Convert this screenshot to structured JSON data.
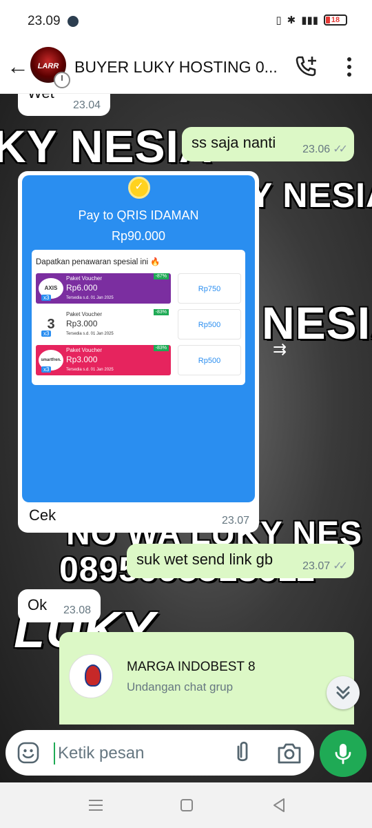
{
  "status_bar": {
    "time": "23.09",
    "battery": "18"
  },
  "header": {
    "title": "BUYER LUKY HOSTING 0...",
    "avatar_label": "LARR"
  },
  "watermark": {
    "line1": "KY NESIA",
    "line2": "Y NESIA",
    "line3": "NESIA",
    "line4": "NO WA LUKY NES",
    "line5": "0895095518611",
    "line6": "LUKY"
  },
  "messages": [
    {
      "dir": "in",
      "text": "Wet",
      "time": "23.04"
    },
    {
      "dir": "out",
      "text": "ss saja nanti",
      "time": "23.06"
    },
    {
      "dir": "in",
      "type": "image",
      "caption": "Cek",
      "time": "23.07"
    },
    {
      "dir": "out",
      "text": "suk wet send link gb",
      "time": "23.07"
    },
    {
      "dir": "in",
      "text": "Ok",
      "time": "23.08"
    }
  ],
  "qris_image": {
    "title": "Pay to QRIS IDAMAN",
    "amount": "Rp90.000",
    "offer_header": "Dapatkan penawaran spesial ini 🔥",
    "vouchers": [
      {
        "brand": "AXIS",
        "label": "Paket Voucher",
        "price": "Rp6.000",
        "valid": "Tersedia s.d. 01 Jan 2025",
        "discount": "-87%",
        "cost": "Rp750",
        "qty": "x3",
        "color": "#7b2ea0"
      },
      {
        "brand": "3",
        "label": "Paket Voucher",
        "price": "Rp3.000",
        "valid": "Tersedia s.d. 01 Jan 2025",
        "discount": "-83%",
        "cost": "Rp500",
        "qty": "x3",
        "color": "#ffffff"
      },
      {
        "brand": "smartfren.",
        "label": "Paket Voucher",
        "price": "Rp3.000",
        "valid": "Tersedia s.d. 01 Jan 2025",
        "discount": "-83%",
        "cost": "Rp500",
        "qty": "x3",
        "color": "#e6245e"
      }
    ]
  },
  "group_invite": {
    "name": "MARGA INDOBEST 8",
    "subtitle": "Undangan chat grup"
  },
  "composer": {
    "placeholder": "Ketik pesan"
  },
  "colors": {
    "accent": "#1faa55",
    "outgoing_bubble": "#dcf8c6",
    "incoming_bubble": "#ffffff",
    "qris_blue": "#2a8ef0"
  },
  "icons": [
    "back-arrow-icon",
    "add-call-icon",
    "more-vert-icon",
    "emoji-icon",
    "attach-icon",
    "camera-icon",
    "mic-icon",
    "forward-icon",
    "double-chevron-down-icon",
    "check-icon"
  ]
}
